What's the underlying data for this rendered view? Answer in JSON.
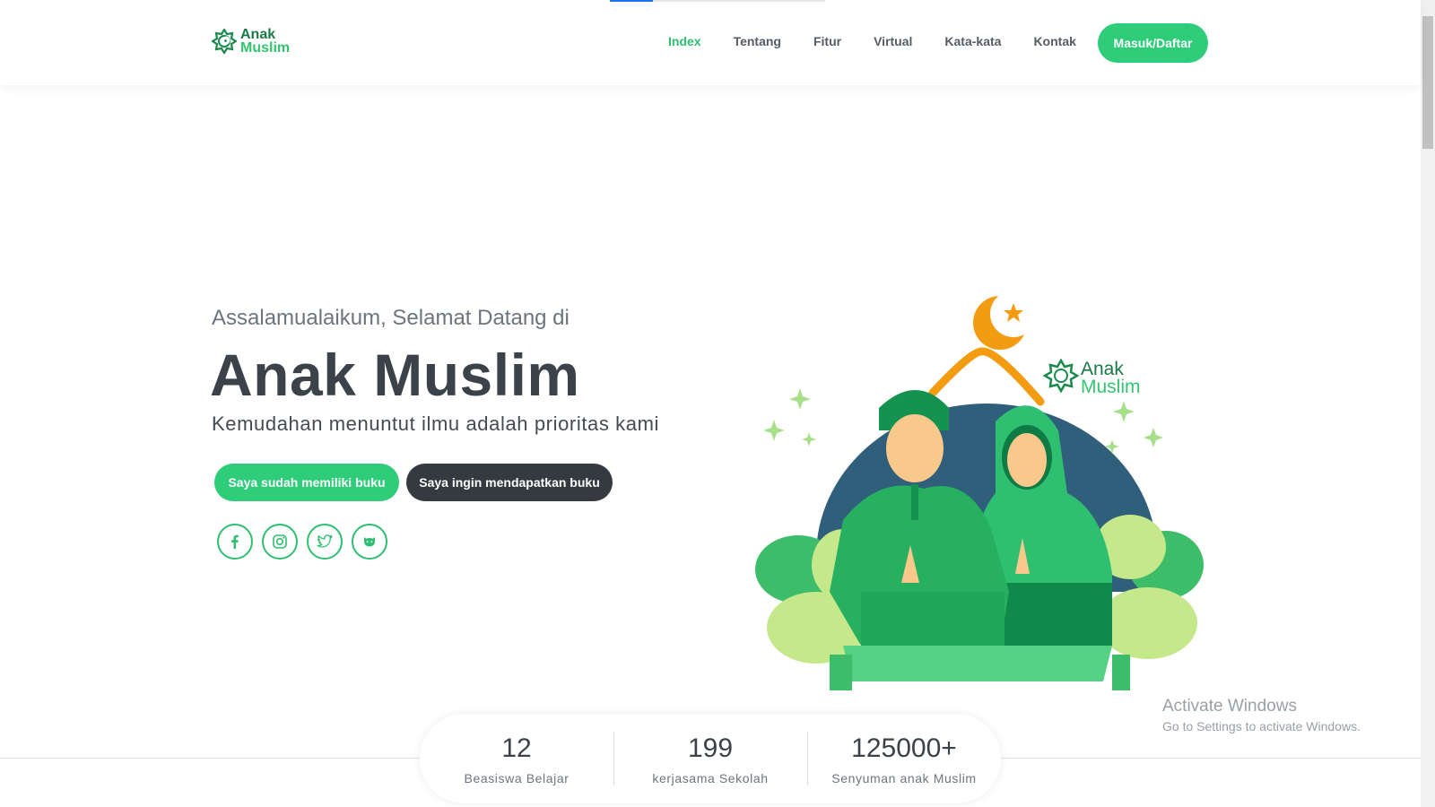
{
  "nav": {
    "logo": {
      "line1": "Anak",
      "line2": "Muslim"
    },
    "items": [
      {
        "label": "Index",
        "active": true
      },
      {
        "label": "Tentang",
        "active": false
      },
      {
        "label": "Fitur",
        "active": false
      },
      {
        "label": "Virtual",
        "active": false
      },
      {
        "label": "Kata-kata",
        "active": false
      },
      {
        "label": "Kontak",
        "active": false
      }
    ],
    "cta_label": "Masuk/Daftar"
  },
  "hero": {
    "greeting": "Assalamualaikum, Selamat Datang di",
    "title": "Anak Muslim",
    "subtitle": "Kemudahan menuntut ilmu adalah prioritas kami",
    "primary_button": "Saya sudah memiliki buku",
    "secondary_button": "Saya ingin mendapatkan buku",
    "socials": [
      "facebook-icon",
      "instagram-icon",
      "twitter-icon",
      "github-icon"
    ],
    "illustration_logo": {
      "line1": "Anak",
      "line2": "Muslim"
    }
  },
  "stats": [
    {
      "value": "12",
      "label": "Beasiswa Belajar"
    },
    {
      "value": "199",
      "label": "kerjasama Sekolah"
    },
    {
      "value": "125000+",
      "label": "Senyuman anak Muslim"
    }
  ],
  "watermark": {
    "title": "Activate Windows",
    "subtitle": "Go to Settings to activate Windows."
  },
  "colors": {
    "accent": "#2fcc7a",
    "dark": "#343a40",
    "text": "#3b4249",
    "muted": "#6c757d"
  }
}
